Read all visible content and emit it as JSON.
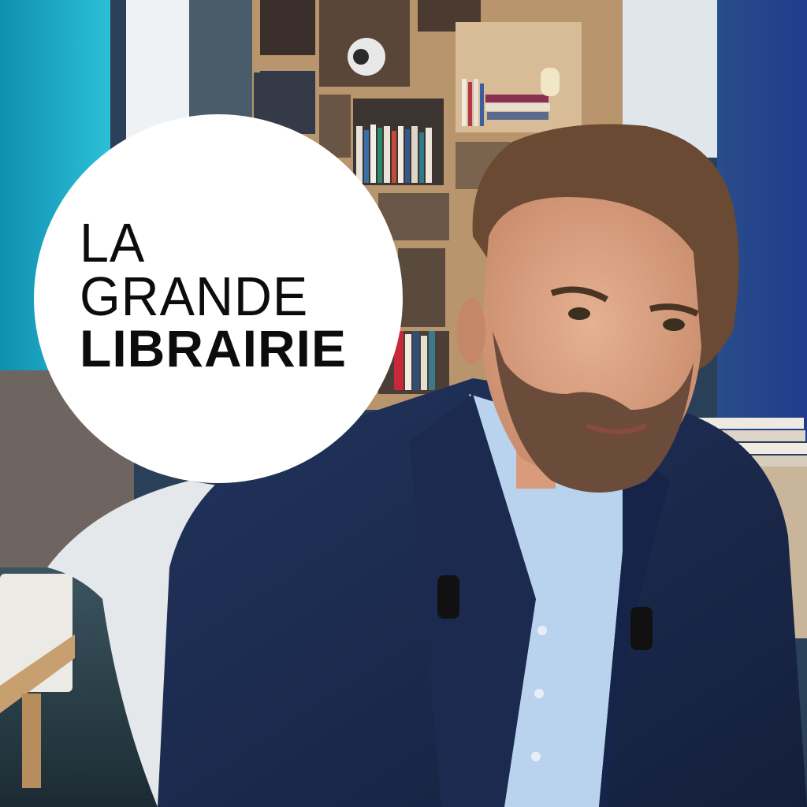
{
  "logo": {
    "line1": "LA",
    "line2": "GRANDE",
    "line3": "LIBRAIRIE"
  },
  "colors": {
    "wall_cyan": "#1aa6c4",
    "suit_navy": "#1b2a4e",
    "shirt_blue": "#b9d3ee",
    "shelf_wood": "#c9a57c",
    "logo_bg": "#ffffff",
    "logo_text": "#0c0c0c"
  }
}
